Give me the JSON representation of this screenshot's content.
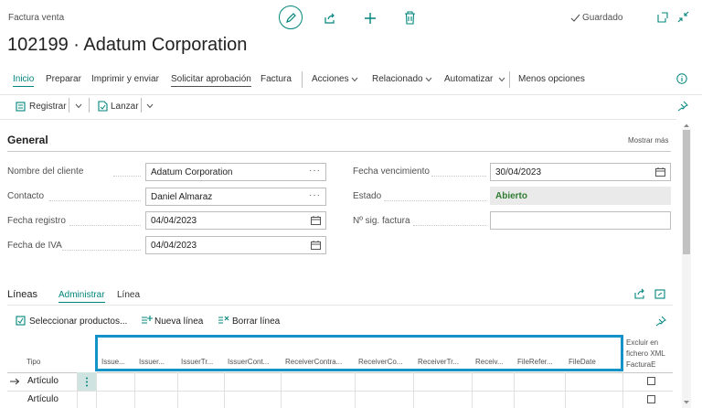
{
  "header": {
    "caption": "Factura venta",
    "title": "102199 · Adatum Corporation",
    "saved_label": "Guardado"
  },
  "menu": {
    "items": [
      "Inicio",
      "Preparar",
      "Imprimir y enviar",
      "Solicitar aprobación",
      "Factura",
      "Acciones",
      "Relacionado",
      "Automatizar",
      "Menos opciones"
    ]
  },
  "actions": {
    "registrar": "Registrar",
    "lanzar": "Lanzar"
  },
  "general": {
    "title": "General",
    "show_more": "Mostrar más",
    "fields_left": [
      {
        "label": "Nombre del cliente",
        "value": "Adatum Corporation"
      },
      {
        "label": "Contacto",
        "value": "Daniel Almaraz"
      },
      {
        "label": "Fecha registro",
        "value": "04/04/2023"
      },
      {
        "label": "Fecha de IVA",
        "value": "04/04/2023"
      }
    ],
    "fields_right": [
      {
        "label": "Fecha vencimiento",
        "value": "30/04/2023"
      },
      {
        "label": "Estado",
        "value": "Abierto"
      },
      {
        "label": "Nº sig. factura",
        "value": ""
      }
    ]
  },
  "lines": {
    "title": "Líneas",
    "tabs": [
      "Administrar",
      "Línea"
    ],
    "actions": [
      "Seleccionar productos...",
      "Nueva línea",
      "Borrar línea"
    ],
    "columns": [
      "Tipo",
      "Issue...",
      "Issuer...",
      "IssuerTr...",
      "IssuerCont...",
      "ReceiverContra...",
      "ReceiverCo...",
      "ReceiverTr...",
      "Receiv...",
      "FileRefer...",
      "FileDate",
      "Excluir en fichero XML FacturaE"
    ],
    "rows": [
      {
        "tipo": "Artículo"
      },
      {
        "tipo": "Artículo"
      }
    ]
  },
  "colors": {
    "accent": "#00857c",
    "highlight": "#1493c8",
    "status": "#2e7d32"
  }
}
